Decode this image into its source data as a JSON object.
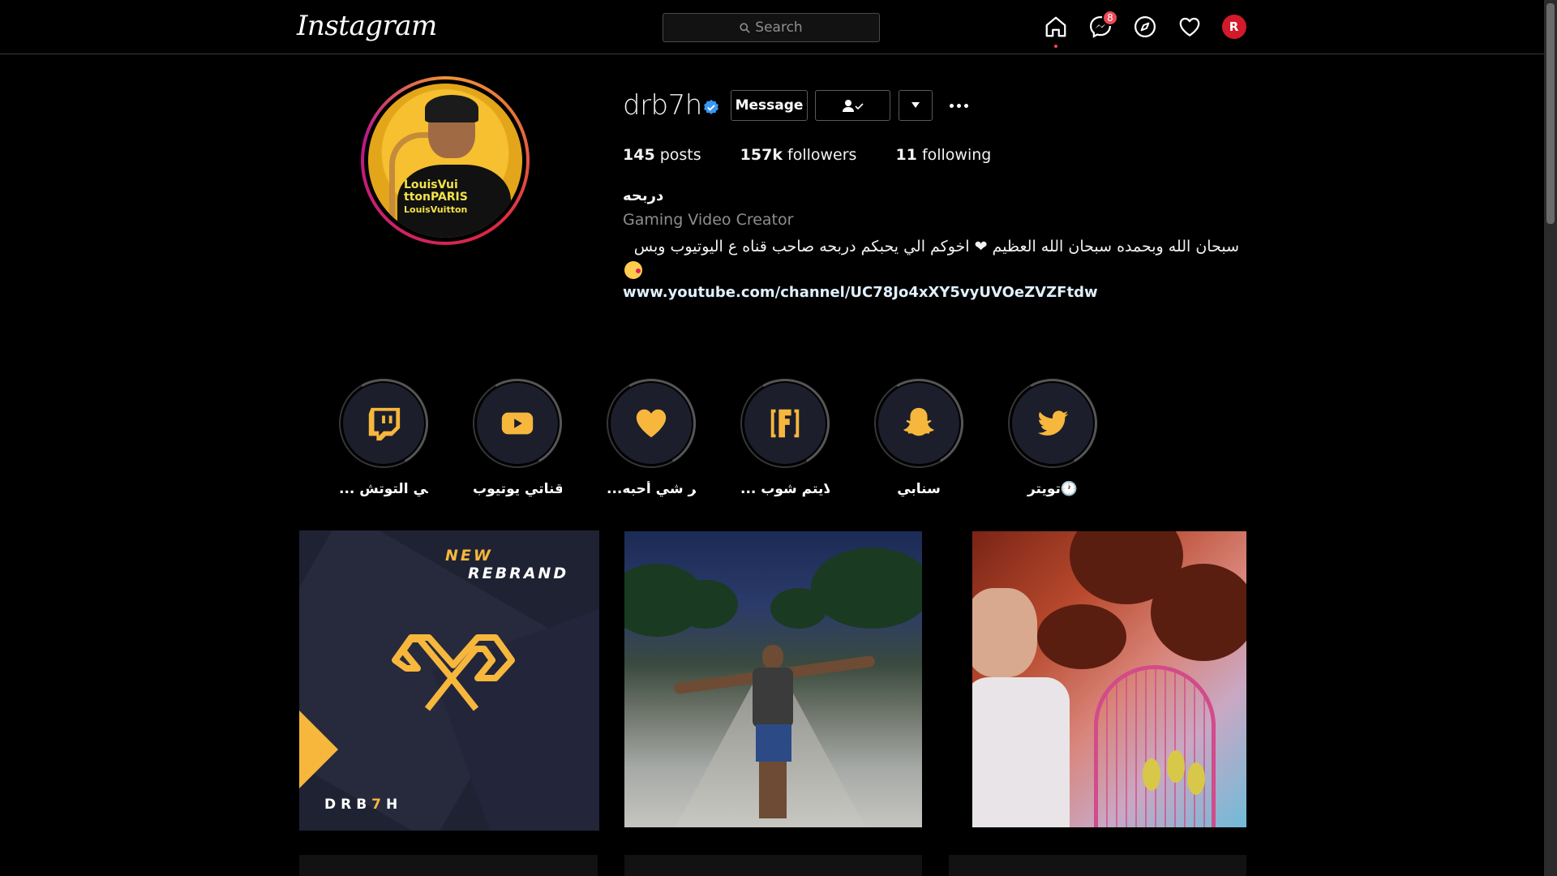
{
  "topbar": {
    "logo_text": "Instagram",
    "search_placeholder": "Search",
    "messages_badge": "8",
    "profile_avatar_letter": "R"
  },
  "profile": {
    "username": "drb7h",
    "verified": true,
    "message_button": "Message",
    "stats": {
      "posts_count": "145",
      "posts_label": "posts",
      "followers_count": "157k",
      "followers_label": "followers",
      "following_count": "11",
      "following_label": "following"
    },
    "full_name": "دربحه",
    "category": "Gaming Video Creator",
    "bio": "سبحان الله وبحمده سبحان الله العظيم ❤ اخوكم الي يحبكم دربحه صاحب قناه ع اليوتيوب وبس",
    "link": "www.youtube.com/channel/UC78Jo4xXY5vyUVOeZVZFtdw",
    "picture_shirt_text": [
      "LouisVui",
      "ttonPARIS",
      "LouisVuitton"
    ]
  },
  "highlights": [
    {
      "label": "... في التوتش",
      "icon": "twitch-icon"
    },
    {
      "label": "قناتي يوتيوب",
      "icon": "youtube-icon"
    },
    {
      "label": "...اكثر شي أحبه",
      "icon": "heart-icon"
    },
    {
      "label": "... الايتم شوب",
      "icon": "fortnite-icon"
    },
    {
      "label": "سنابي",
      "icon": "snapchat-icon"
    },
    {
      "label": "تويتر🕐",
      "icon": "twitter-icon"
    }
  ],
  "posts": {
    "post1": {
      "line1": "NEW",
      "line2": "REBRAND",
      "brand_a": "DRB",
      "brand_b": "7",
      "brand_c": "H"
    }
  },
  "colors": {
    "accent_yellow": "#f6b73c",
    "badge_red": "#ed4956",
    "highlight_bg": "#1c1e2c",
    "link": "#e0f1ff"
  }
}
